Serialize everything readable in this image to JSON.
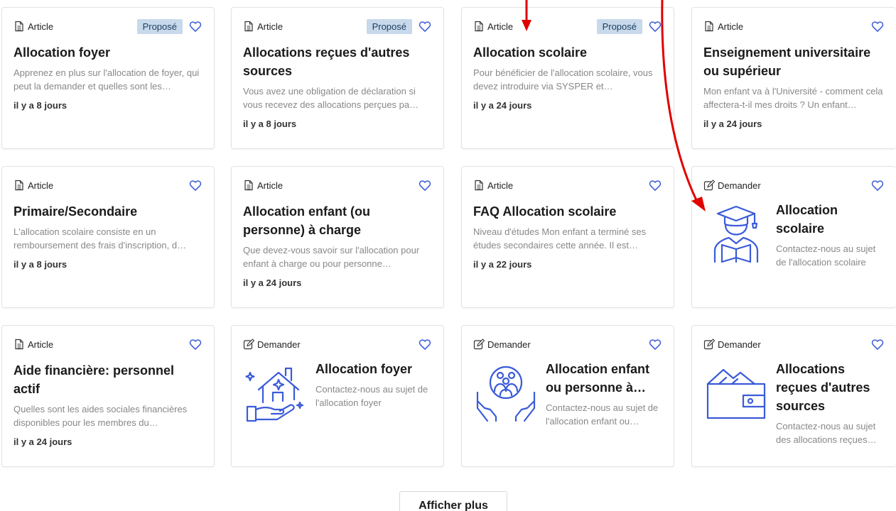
{
  "labels": {
    "article": "Article",
    "request": "Demander",
    "proposed": "Proposé"
  },
  "cards": [
    {
      "type": "Article",
      "proposed": "Proposé",
      "title": "Allocation foyer",
      "desc": "Apprenez en plus sur l'allocation de foyer, qui peut la demander et quelles sont les…",
      "date": "il y a 8 jours"
    },
    {
      "type": "Article",
      "proposed": "Proposé",
      "title": "Allocations reçues d'autres sources",
      "desc": "Vous avez une obligation de déclaration si vous recevez des allocations perçues pa…",
      "date": "il y a 8 jours"
    },
    {
      "type": "Article",
      "proposed": "Proposé",
      "title": "Allocation scolaire",
      "desc": "Pour bénéficier de l'allocation scolaire, vous devez introduire via SYSPER et…",
      "date": "il y a 24 jours"
    },
    {
      "type": "Article",
      "title": "Enseignement universitaire ou supérieur",
      "desc": "Mon enfant va à l'Université - comment cela affectera-t-il mes droits ? Un enfant…",
      "date": "il y a 24 jours"
    },
    {
      "type": "Article",
      "title": "Primaire/Secondaire",
      "desc": "L'allocation scolaire consiste en un remboursement des frais d'inscription, d…",
      "date": "il y a 8 jours"
    },
    {
      "type": "Article",
      "title": "Allocation enfant (ou personne) à charge",
      "desc": "Que devez-vous savoir sur l'allocation pour enfant à charge ou pour personne…",
      "date": "il y a 24 jours"
    },
    {
      "type": "Article",
      "title": "FAQ Allocation scolaire",
      "desc": "Niveau d'études Mon enfant a terminé ses études secondaires cette année. Il est…",
      "date": "il y a 22 jours"
    },
    {
      "type": "Demander",
      "icon": "graduate-reading-icon",
      "title": "Allocation scolaire",
      "desc": "Contactez-nous au sujet de l'allocation scolaire"
    },
    {
      "type": "Article",
      "title": "Aide financière: personnel actif",
      "desc": "Quelles sont les aides sociales financières disponibles pour les membres du…",
      "date": "il y a 24 jours"
    },
    {
      "type": "Demander",
      "icon": "house-in-hand-icon",
      "title": "Allocation foyer",
      "desc": "Contactez-nous au sujet de l'allocation foyer"
    },
    {
      "type": "Demander",
      "icon": "family-in-hands-icon",
      "title": "Allocation enfant ou personne à…",
      "desc": "Contactez-nous au sujet de l'allocation enfant ou…"
    },
    {
      "type": "Demander",
      "icon": "wallet-icon",
      "title": "Allocations reçues d'autres sources",
      "desc": "Contactez-nous au sujet des allocations reçues…"
    }
  ],
  "show_more": "Afficher plus",
  "colors": {
    "accent": "#3a5bd9",
    "badge_bg": "#c7d9eb",
    "annotation": "#e00000"
  }
}
